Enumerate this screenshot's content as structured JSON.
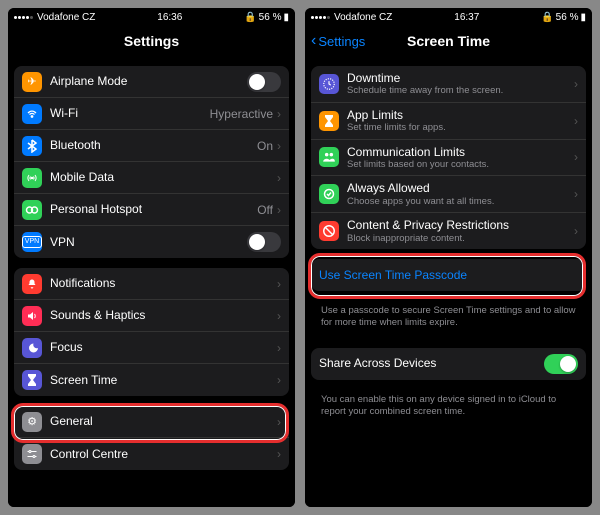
{
  "left": {
    "status": {
      "carrier": "Vodafone CZ",
      "time": "16:36",
      "battery": "56 %"
    },
    "title": "Settings",
    "group1": [
      {
        "icon": "airplane",
        "bg": "#ff9500",
        "label": "Airplane Mode",
        "toggle": false
      },
      {
        "icon": "wifi",
        "bg": "#007aff",
        "label": "Wi-Fi",
        "value": "Hyperactive"
      },
      {
        "icon": "bluetooth",
        "bg": "#007aff",
        "label": "Bluetooth",
        "value": "On"
      },
      {
        "icon": "mobile",
        "bg": "#30d158",
        "label": "Mobile Data"
      },
      {
        "icon": "hotspot",
        "bg": "#30d158",
        "label": "Personal Hotspot",
        "value": "Off"
      },
      {
        "icon": "vpn",
        "bg": "#007aff",
        "label": "VPN",
        "toggle": false
      }
    ],
    "group2": [
      {
        "icon": "notif",
        "bg": "#ff3b30",
        "label": "Notifications"
      },
      {
        "icon": "sounds",
        "bg": "#ff2d55",
        "label": "Sounds & Haptics"
      },
      {
        "icon": "focus",
        "bg": "#5856d6",
        "label": "Focus"
      },
      {
        "icon": "screentime",
        "bg": "#5856d6",
        "label": "Screen Time"
      }
    ],
    "group3": [
      {
        "icon": "general",
        "bg": "#8e8e93",
        "label": "General"
      },
      {
        "icon": "control",
        "bg": "#8e8e93",
        "label": "Control Centre"
      }
    ]
  },
  "right": {
    "status": {
      "carrier": "Vodafone CZ",
      "time": "16:37",
      "battery": "56 %"
    },
    "back": "Settings",
    "title": "Screen Time",
    "group1": [
      {
        "icon": "downtime",
        "bg": "#5856d6",
        "label": "Downtime",
        "sub": "Schedule time away from the screen."
      },
      {
        "icon": "applimits",
        "bg": "#ff9500",
        "label": "App Limits",
        "sub": "Set time limits for apps."
      },
      {
        "icon": "comm",
        "bg": "#30d158",
        "label": "Communication Limits",
        "sub": "Set limits based on your contacts."
      },
      {
        "icon": "always",
        "bg": "#30d158",
        "label": "Always Allowed",
        "sub": "Choose apps you want at all times."
      },
      {
        "icon": "restrict",
        "bg": "#ff3b30",
        "label": "Content & Privacy Restrictions",
        "sub": "Block inappropriate content."
      }
    ],
    "passcode": {
      "link": "Use Screen Time Passcode",
      "footer": "Use a passcode to secure Screen Time settings and to allow for more time when limits expire."
    },
    "share": {
      "label": "Share Across Devices",
      "toggle": true,
      "footer": "You can enable this on any device signed in to iCloud to report your combined screen time."
    }
  }
}
